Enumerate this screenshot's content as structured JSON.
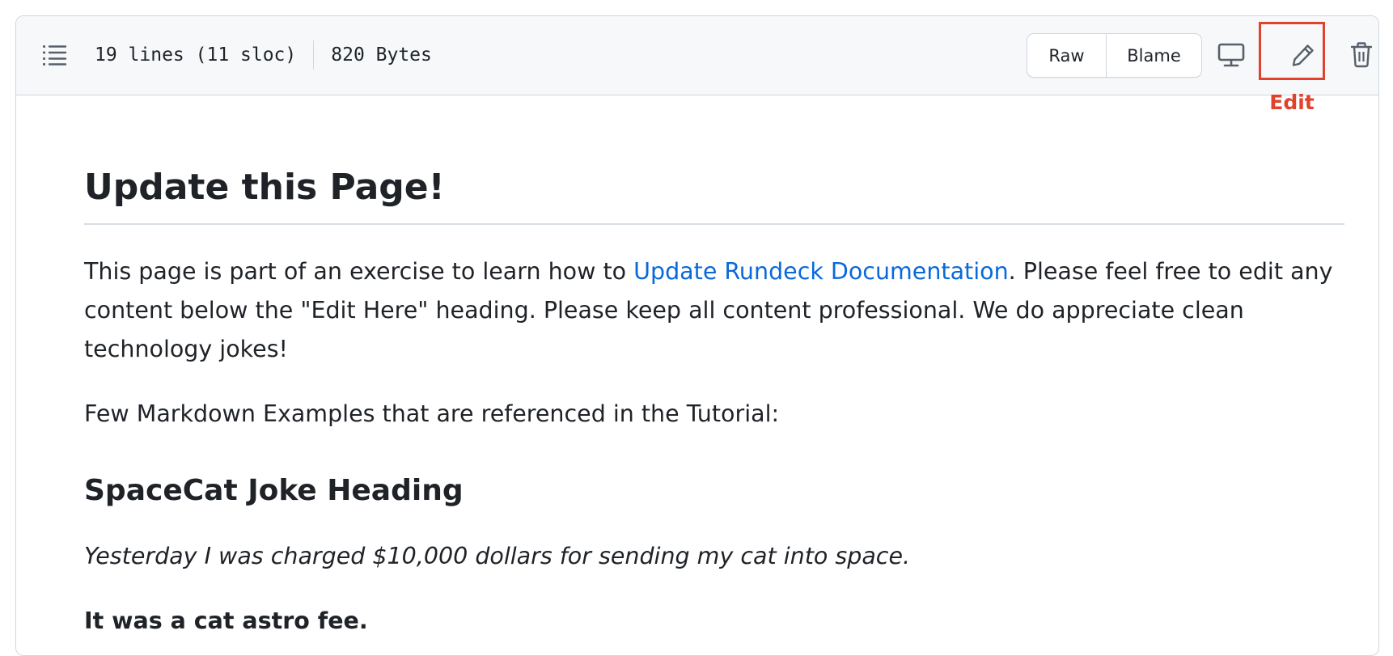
{
  "header": {
    "lines": "19 lines (11 sloc)",
    "size": "820 Bytes",
    "raw_label": "Raw",
    "blame_label": "Blame",
    "icons": {
      "outline": "list-unordered-icon",
      "display": "desktop-icon",
      "edit": "pencil-icon",
      "delete": "trash-icon"
    }
  },
  "annotation": {
    "edit_label": "Edit",
    "color": "#e2412b"
  },
  "content": {
    "title": "Update this Page!",
    "intro_before": "This page is part of an exercise to learn how to ",
    "intro_link": "Update Rundeck Documentation",
    "intro_after": ". Please feel free to edit any content below the \"Edit Here\" heading. Please keep all content professional. We do appreciate clean technology jokes!",
    "examples": "Few Markdown Examples that are referenced in the Tutorial:",
    "joke_heading": "SpaceCat Joke Heading",
    "joke_line": "Yesterday I was charged $10,000 dollars for sending my cat into space.",
    "punchline": "It was a cat astro fee."
  },
  "colors": {
    "link": "#0969da",
    "text": "#1f2328",
    "header_bg": "#f6f8fa",
    "border": "#d0d7de"
  }
}
